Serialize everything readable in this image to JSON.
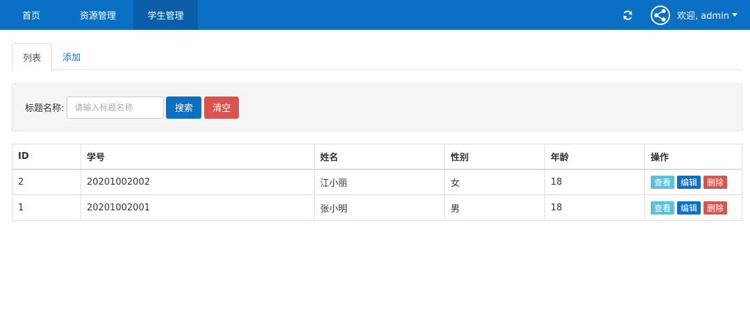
{
  "nav": {
    "items": [
      {
        "label": "首页"
      },
      {
        "label": "资源管理"
      },
      {
        "label": "学生管理"
      }
    ],
    "user_greeting": "欢迎, admin",
    "icons": {
      "refresh": "refresh-icon",
      "avatar": "share-node-icon",
      "caret": "caret-down-icon"
    },
    "colors": {
      "bar": "#0b6fc4",
      "active": "#0a5ea8"
    }
  },
  "tabs": [
    {
      "label": "列表",
      "active": true
    },
    {
      "label": "添加",
      "active": false
    }
  ],
  "search": {
    "label": "标题名称:",
    "placeholder": "请输入标题名称",
    "value": "",
    "search_label": "搜索",
    "clear_label": "清空"
  },
  "table": {
    "headers": [
      "ID",
      "学号",
      "姓名",
      "性别",
      "年龄",
      "操作"
    ],
    "rows": [
      {
        "id": "2",
        "student_no": "20201002002",
        "name": "江小丽",
        "gender": "女",
        "age": "18"
      },
      {
        "id": "1",
        "student_no": "20201002001",
        "name": "张小明",
        "gender": "男",
        "age": "18"
      }
    ],
    "actions": {
      "view": "查看",
      "edit": "编辑",
      "delete": "删除"
    }
  }
}
